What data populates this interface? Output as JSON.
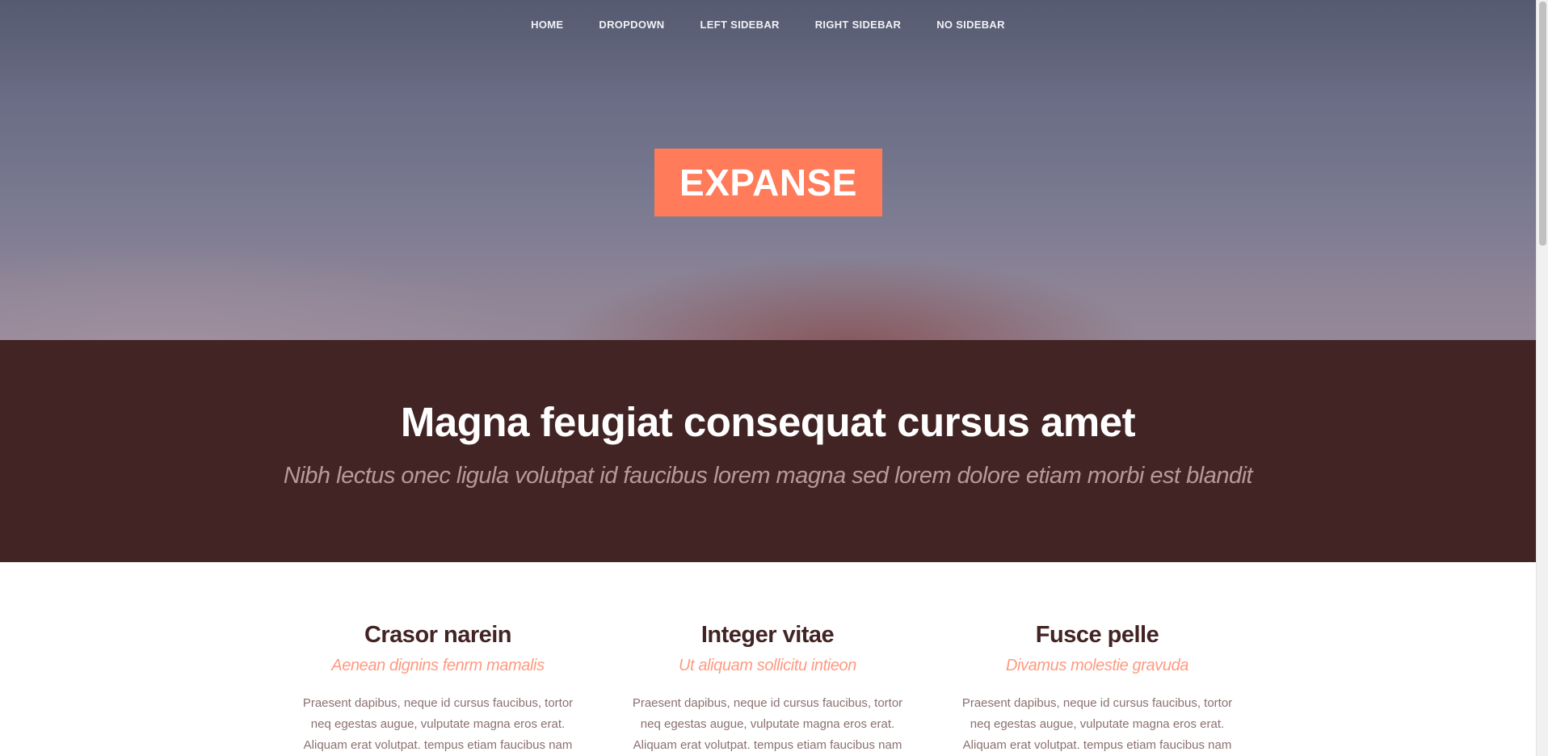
{
  "nav": {
    "items": [
      {
        "label": "HOME"
      },
      {
        "label": "DROPDOWN"
      },
      {
        "label": "LEFT SIDEBAR"
      },
      {
        "label": "RIGHT SIDEBAR"
      },
      {
        "label": "NO SIDEBAR"
      }
    ]
  },
  "logo": {
    "text": "EXPANSE"
  },
  "banner": {
    "title": "Magna feugiat consequat cursus amet",
    "subtitle": "Nibh lectus onec ligula volutpat id faucibus lorem magna sed lorem dolore etiam morbi est blandit"
  },
  "features": [
    {
      "title": "Crasor narein",
      "subtitle": "Aenean dignins fenrm mamalis",
      "body": "Praesent dapibus, neque id cursus faucibus, tortor neq egestas augue, vulputate magna eros erat. Aliquam erat volutpat. tempus etiam faucibus nam accumsan."
    },
    {
      "title": "Integer vitae",
      "subtitle": "Ut aliquam sollicitu intieon",
      "body": "Praesent dapibus, neque id cursus faucibus, tortor neq egestas augue, vulputate magna eros erat. Aliquam erat volutpat. tempus etiam faucibus nam accumsan."
    },
    {
      "title": "Fusce pelle",
      "subtitle": "Divamus molestie gravuda",
      "body": "Praesent dapibus, neque id cursus faucibus, tortor neq egestas augue, vulputate magna eros erat. Aliquam erat volutpat. tempus etiam faucibus nam accumsan."
    }
  ],
  "colors": {
    "accent": "#ff7b5a",
    "banner_bg": "#432424",
    "heading": "#432424",
    "subheading": "#ff9a80",
    "body_text": "#8a7170"
  }
}
